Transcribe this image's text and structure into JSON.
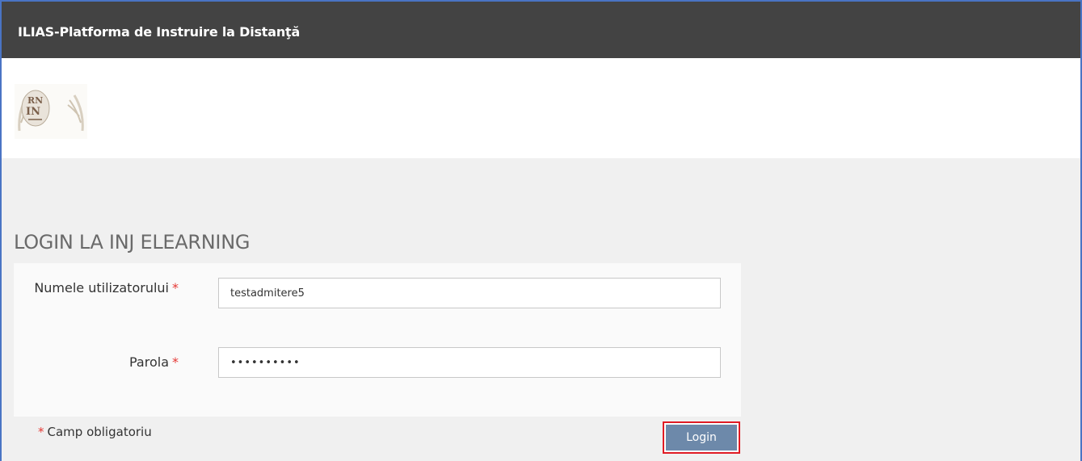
{
  "header": {
    "title": "ILIAS-Platforma de Instruire la Distanţă"
  },
  "logo": {
    "icon": "institution-logo-icon"
  },
  "login": {
    "heading": "LOGIN LA INJ ELEARNING",
    "username_label": "Numele utilizatorului",
    "username_value": "testadmitere5",
    "password_label": "Parola",
    "password_value": "••••••••••",
    "required_marker": "*",
    "required_note": "Camp obligatoriu",
    "submit_label": "Login"
  },
  "colors": {
    "header_bg": "#434343",
    "page_bg": "#f0f0f0",
    "button_bg": "#6d89aa",
    "required_red": "#e53935",
    "highlight_border": "#e01b24"
  }
}
